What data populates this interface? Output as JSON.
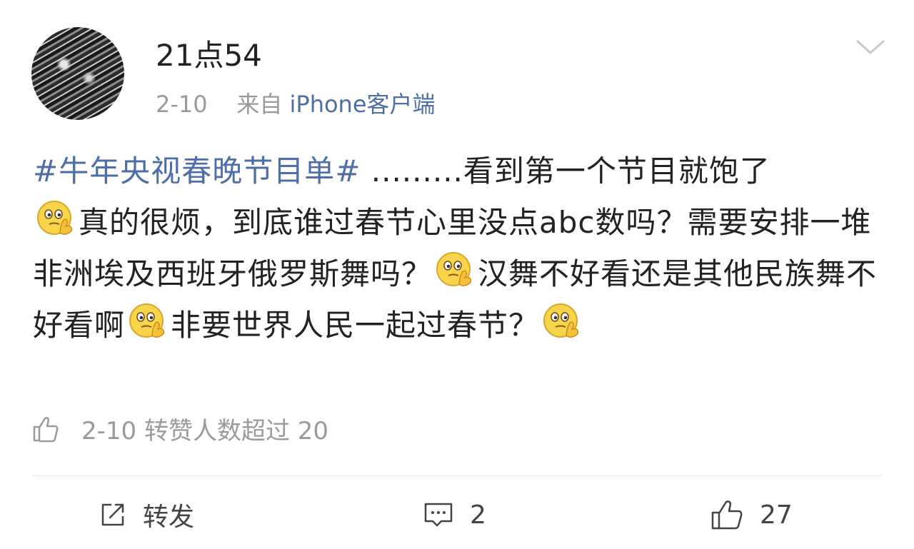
{
  "post": {
    "author": "21点54",
    "time": "2-10",
    "source_prefix": "来自",
    "source": "iPhone客户端",
    "topic": "#牛年央视春晚节目单#",
    "text_parts": [
      " .........看到第一个节目就饱了",
      "真的很烦，到底谁过春节心里没点abc数吗？需要安排一堆非洲埃及西班牙俄罗斯舞吗？",
      "汉舞不好看还是其他民族舞不好看啊",
      "非要世界人民一起过春节？"
    ],
    "like_note": "2-10 转赞人数超过 20"
  },
  "actions": {
    "repost_label": "转发",
    "comment_count": "2",
    "like_count": "27"
  },
  "icons": {
    "emoji": "thinking-face-emoji",
    "chevron": "chevron-down-icon",
    "thumb": "thumbs-up-icon",
    "repost": "share-icon",
    "comment": "comment-icon"
  },
  "colors": {
    "link": "#4e6ea8",
    "muted": "#9a9a9a",
    "text": "#222222"
  }
}
